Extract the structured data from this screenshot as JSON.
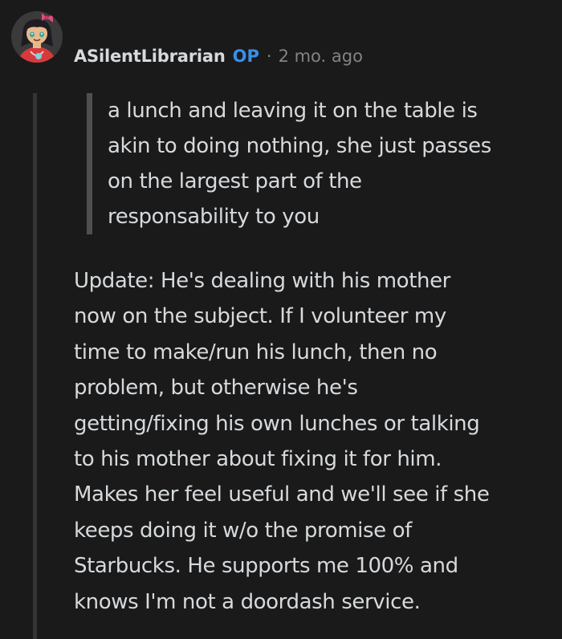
{
  "comment": {
    "author": "ASilentLibrarian",
    "badge": "OP",
    "separator": "·",
    "time": "2 mo. ago",
    "avatar_icon": "avatar-icon",
    "quote_lines": [
      "a lunch and leaving it on the table is",
      "akin to doing nothing, she just passes",
      "on the largest part of the",
      "responsability to you"
    ],
    "body_lines": [
      "Update: He's dealing with his mother",
      "now on the subject. If I volunteer my",
      "time to make/run his lunch, then no",
      "problem, but otherwise he's",
      "getting/fixing his own lunches or talking",
      "to his mother about fixing it for him.",
      "Makes her feel useful and we'll see if she",
      "keeps doing it w/o the promise of",
      "Starbucks. He supports me 100% and",
      "knows I'm not a doordash service."
    ]
  },
  "colors": {
    "background": "#1a1a1b",
    "text": "#d7dadc",
    "op_badge": "#3b8ee8",
    "meta": "#818384"
  }
}
